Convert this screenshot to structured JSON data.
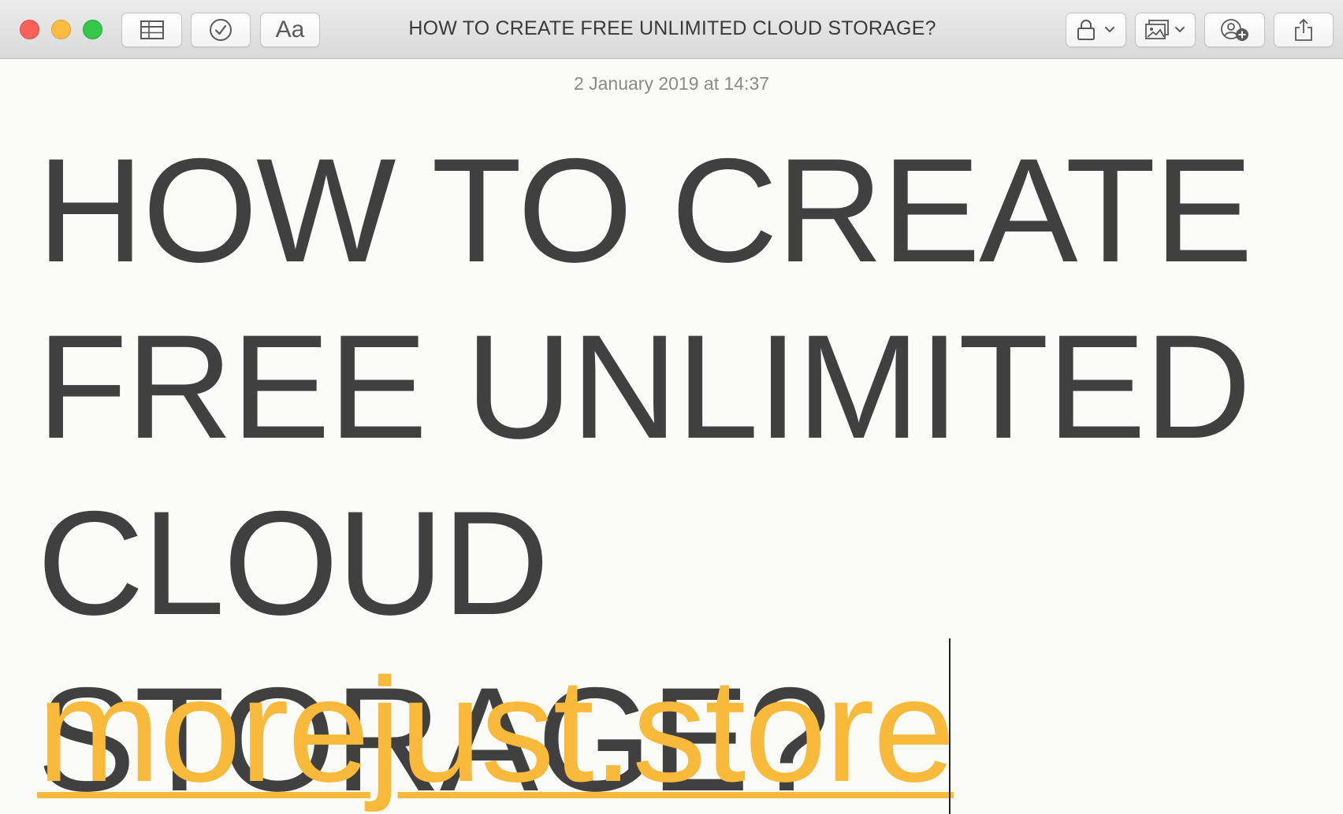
{
  "window": {
    "title": "HOW TO CREATE FREE UNLIMITED CLOUD STORAGE?"
  },
  "toolbar": {
    "format_label": "Aa",
    "icons": {
      "table": "table-icon",
      "checklist": "checklist-icon",
      "lock": "lock-icon",
      "media": "photo-icon",
      "add_people": "add-person-icon",
      "share": "share-icon"
    }
  },
  "note": {
    "date": "2 January 2019 at 14:37",
    "title_lines": [
      "HOW TO CREATE",
      "FREE UNLIMITED",
      "CLOUD STORAGE?"
    ],
    "link_text": "morejust.store"
  },
  "colors": {
    "close": "#fc605b",
    "minimize": "#fdbc40",
    "zoom": "#34c84a",
    "title_text": "#404040",
    "link": "#f9b93a",
    "date": "#8a8a8a"
  }
}
